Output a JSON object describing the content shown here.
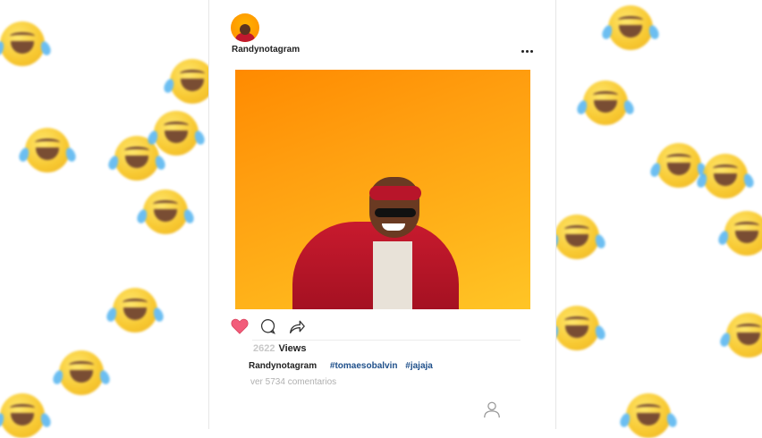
{
  "post": {
    "username_header": "Randynotagram",
    "views_count": "2622",
    "views_label": "Views",
    "caption_user": "Randynotagram",
    "hashtags": [
      "#tomaesobalvin",
      "#jajaja"
    ],
    "comments_link": "ver 5734 comentarios",
    "liked": true
  },
  "icons": {
    "heart": "heart-icon",
    "comment": "comment-icon",
    "share": "share-icon",
    "more": "more-icon",
    "profile": "profile-icon"
  },
  "colors": {
    "heart": "#f25c7a",
    "hashtag": "#1e4f8a",
    "photo_top": "#ff8a00",
    "photo_bottom": "#ffc526"
  }
}
